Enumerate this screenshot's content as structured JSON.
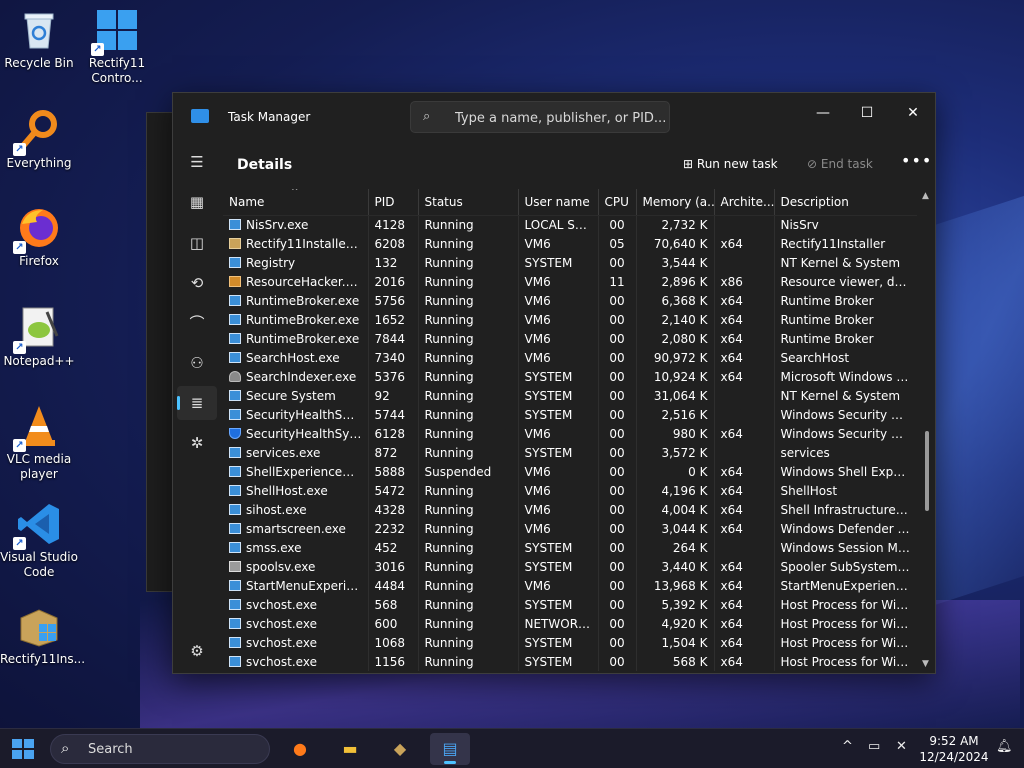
{
  "desktop": {
    "icons": [
      {
        "label": "Recycle Bin"
      },
      {
        "label": "Rectify11 Contro..."
      },
      {
        "label": "Everything"
      },
      {
        "label": "Firefox"
      },
      {
        "label": "Notepad++"
      },
      {
        "label": "VLC media player"
      },
      {
        "label": "Visual Studio Code"
      },
      {
        "label": "Rectify11Ins..."
      }
    ]
  },
  "window": {
    "title": "Task Manager",
    "search_placeholder": "Type a name, publisher, or PID...",
    "minimize": "—",
    "maximize": "☐",
    "close": "✕"
  },
  "header": {
    "page_title": "Details",
    "run_new_task": "Run new task",
    "end_task": "End task",
    "more": "•••"
  },
  "table": {
    "columns": [
      "Name",
      "PID",
      "Status",
      "User name",
      "CPU",
      "Memory (a...",
      "Archite...",
      "Description"
    ],
    "rows": [
      {
        "icon": "app",
        "name": "NisSrv.exe",
        "pid": "4128",
        "status": "Running",
        "user": "LOCAL SE...",
        "cpu": "00",
        "mem": "2,732 K",
        "arch": "",
        "desc": "NisSrv"
      },
      {
        "icon": "folder",
        "name": "Rectify11Installer.exe",
        "pid": "6208",
        "status": "Running",
        "user": "VM6",
        "cpu": "05",
        "mem": "70,640 K",
        "arch": "x64",
        "desc": "Rectify11Installer"
      },
      {
        "icon": "app",
        "name": "Registry",
        "pid": "132",
        "status": "Running",
        "user": "SYSTEM",
        "cpu": "00",
        "mem": "3,544 K",
        "arch": "",
        "desc": "NT Kernel & System"
      },
      {
        "icon": "res",
        "name": "ResourceHacker.exe",
        "pid": "2016",
        "status": "Running",
        "user": "VM6",
        "cpu": "11",
        "mem": "2,896 K",
        "arch": "x86",
        "desc": "Resource viewer, deco..."
      },
      {
        "icon": "app",
        "name": "RuntimeBroker.exe",
        "pid": "5756",
        "status": "Running",
        "user": "VM6",
        "cpu": "00",
        "mem": "6,368 K",
        "arch": "x64",
        "desc": "Runtime Broker"
      },
      {
        "icon": "app",
        "name": "RuntimeBroker.exe",
        "pid": "1652",
        "status": "Running",
        "user": "VM6",
        "cpu": "00",
        "mem": "2,140 K",
        "arch": "x64",
        "desc": "Runtime Broker"
      },
      {
        "icon": "app",
        "name": "RuntimeBroker.exe",
        "pid": "7844",
        "status": "Running",
        "user": "VM6",
        "cpu": "00",
        "mem": "2,080 K",
        "arch": "x64",
        "desc": "Runtime Broker"
      },
      {
        "icon": "app",
        "name": "SearchHost.exe",
        "pid": "7340",
        "status": "Running",
        "user": "VM6",
        "cpu": "00",
        "mem": "90,972 K",
        "arch": "x64",
        "desc": "SearchHost"
      },
      {
        "icon": "person",
        "name": "SearchIndexer.exe",
        "pid": "5376",
        "status": "Running",
        "user": "SYSTEM",
        "cpu": "00",
        "mem": "10,924 K",
        "arch": "x64",
        "desc": "Microsoft Windows Se..."
      },
      {
        "icon": "app",
        "name": "Secure System",
        "pid": "92",
        "status": "Running",
        "user": "SYSTEM",
        "cpu": "00",
        "mem": "31,064 K",
        "arch": "",
        "desc": "NT Kernel & System"
      },
      {
        "icon": "app",
        "name": "SecurityHealthServic...",
        "pid": "5744",
        "status": "Running",
        "user": "SYSTEM",
        "cpu": "00",
        "mem": "2,516 K",
        "arch": "",
        "desc": "Windows Security Hea..."
      },
      {
        "icon": "shield",
        "name": "SecurityHealthSystra...",
        "pid": "6128",
        "status": "Running",
        "user": "VM6",
        "cpu": "00",
        "mem": "980 K",
        "arch": "x64",
        "desc": "Windows Security noti..."
      },
      {
        "icon": "app",
        "name": "services.exe",
        "pid": "872",
        "status": "Running",
        "user": "SYSTEM",
        "cpu": "00",
        "mem": "3,572 K",
        "arch": "",
        "desc": "services"
      },
      {
        "icon": "app",
        "name": "ShellExperienceHost....",
        "pid": "5888",
        "status": "Suspended",
        "user": "VM6",
        "cpu": "00",
        "mem": "0 K",
        "arch": "x64",
        "desc": "Windows Shell Experie..."
      },
      {
        "icon": "app",
        "name": "ShellHost.exe",
        "pid": "5472",
        "status": "Running",
        "user": "VM6",
        "cpu": "00",
        "mem": "4,196 K",
        "arch": "x64",
        "desc": "ShellHost"
      },
      {
        "icon": "app",
        "name": "sihost.exe",
        "pid": "4328",
        "status": "Running",
        "user": "VM6",
        "cpu": "00",
        "mem": "4,004 K",
        "arch": "x64",
        "desc": "Shell Infrastructure Host"
      },
      {
        "icon": "app",
        "name": "smartscreen.exe",
        "pid": "2232",
        "status": "Running",
        "user": "VM6",
        "cpu": "00",
        "mem": "3,044 K",
        "arch": "x64",
        "desc": "Windows Defender S..."
      },
      {
        "icon": "app",
        "name": "smss.exe",
        "pid": "452",
        "status": "Running",
        "user": "SYSTEM",
        "cpu": "00",
        "mem": "264 K",
        "arch": "",
        "desc": "Windows Session Man..."
      },
      {
        "icon": "printer",
        "name": "spoolsv.exe",
        "pid": "3016",
        "status": "Running",
        "user": "SYSTEM",
        "cpu": "00",
        "mem": "3,440 K",
        "arch": "x64",
        "desc": "Spooler SubSystem App"
      },
      {
        "icon": "app",
        "name": "StartMenuExperienc...",
        "pid": "4484",
        "status": "Running",
        "user": "VM6",
        "cpu": "00",
        "mem": "13,968 K",
        "arch": "x64",
        "desc": "StartMenuExperience..."
      },
      {
        "icon": "app",
        "name": "svchost.exe",
        "pid": "568",
        "status": "Running",
        "user": "SYSTEM",
        "cpu": "00",
        "mem": "5,392 K",
        "arch": "x64",
        "desc": "Host Process for Wind..."
      },
      {
        "icon": "app",
        "name": "svchost.exe",
        "pid": "600",
        "status": "Running",
        "user": "NETWORK...",
        "cpu": "00",
        "mem": "4,920 K",
        "arch": "x64",
        "desc": "Host Process for Wind..."
      },
      {
        "icon": "app",
        "name": "svchost.exe",
        "pid": "1068",
        "status": "Running",
        "user": "SYSTEM",
        "cpu": "00",
        "mem": "1,504 K",
        "arch": "x64",
        "desc": "Host Process for Wind..."
      },
      {
        "icon": "app",
        "name": "svchost.exe",
        "pid": "1156",
        "status": "Running",
        "user": "SYSTEM",
        "cpu": "00",
        "mem": "568 K",
        "arch": "x64",
        "desc": "Host Process for Wind..."
      }
    ]
  },
  "taskbar": {
    "search_label": "Search",
    "time": "9:52 AM",
    "date": "12/24/2024"
  },
  "colors": {
    "accent": "#4cc2ff",
    "window_bg": "#202020"
  }
}
